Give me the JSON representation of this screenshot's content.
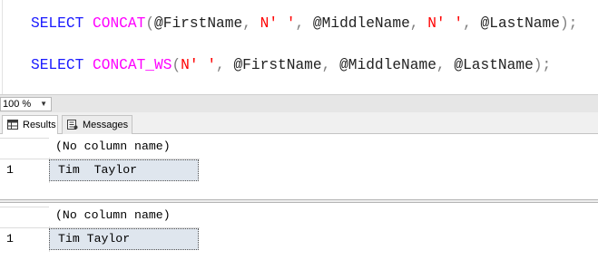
{
  "editor": {
    "line1": {
      "kw": "SELECT",
      "fn": "CONCAT",
      "p_open": "(",
      "var1": "@FirstName",
      "c1": ", ",
      "str1": "N' '",
      "c2": ", ",
      "var2": "@MiddleName",
      "c3": ", ",
      "str2": "N' '",
      "c4": ", ",
      "var3": "@LastName",
      "end": ");"
    },
    "line2": {
      "kw": "SELECT",
      "fn": "CONCAT_WS",
      "p_open": "(",
      "str1": "N' '",
      "c1": ", ",
      "var1": "@FirstName",
      "c2": ", ",
      "var2": "@MiddleName",
      "c3": ", ",
      "var3": "@LastName",
      "end": ");"
    }
  },
  "zoom": {
    "value": "100 %"
  },
  "tabs": [
    {
      "label": "Results",
      "icon": "grid-icon",
      "active": true
    },
    {
      "label": "Messages",
      "icon": "messages-icon",
      "active": false
    }
  ],
  "results": [
    {
      "column_header": "(No column name)",
      "rows": [
        {
          "row_number": "1",
          "value": "Tim  Taylor"
        }
      ]
    },
    {
      "column_header": "(No column name)",
      "rows": [
        {
          "row_number": "1",
          "value": "Tim Taylor"
        }
      ]
    }
  ]
}
